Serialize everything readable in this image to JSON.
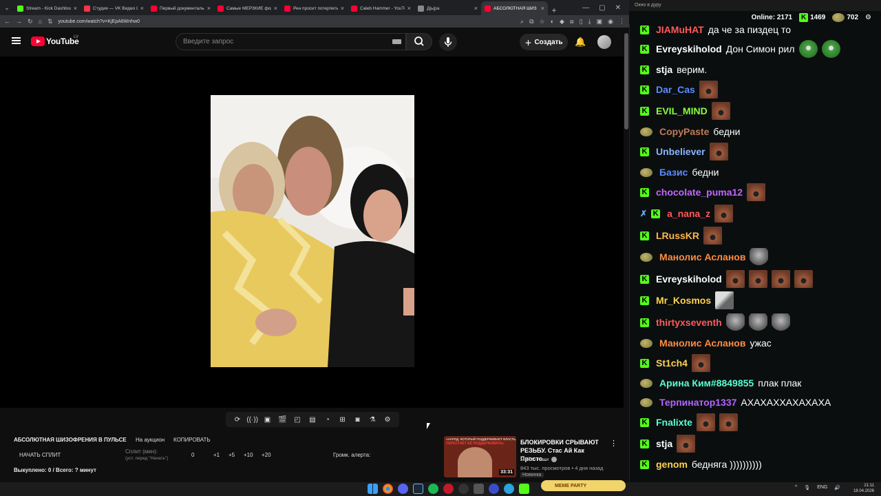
{
  "browser": {
    "tabs": [
      {
        "label": "Stream - Kick Dashboard",
        "color": "#53fc18"
      },
      {
        "label": "Студия — VK Видео Li",
        "color": "#ff3347"
      },
      {
        "label": "Первый документальн",
        "color": "#ff0033"
      },
      {
        "label": "Самые МЕРЗКИЕ фору",
        "color": "#ff0033"
      },
      {
        "label": "Рен просит потерпеть",
        "color": "#ff0033"
      },
      {
        "label": "Caleb Hammer - YouTu",
        "color": "#ff0033"
      },
      {
        "label": "Д|ь|ра",
        "color": "#888888"
      },
      {
        "label": "АБСОЛЮТНАЯ ШИЗ",
        "color": "#ff0033"
      }
    ],
    "url": "youtube.com/watch?v=KjEpA6Wnhw0"
  },
  "youtube": {
    "logo": "YouTube",
    "country": "LV",
    "search_placeholder": "Введите запрос",
    "create_label": "Создать"
  },
  "auction": {
    "title": "АБСОЛЮТНАЯ ШИЗОФРЕНИЯ В ПУЛЬСЕ",
    "on_auction": "На аукцион",
    "copy": "КОПИРОВАТЬ",
    "start_split": "НАЧАТЬ СПЛИТ",
    "split_label": "Сплит (мин):",
    "split_hint": "(уст. перед \"Начать\")",
    "split_value": "0",
    "plus1": "+1",
    "plus5": "+5",
    "plus10": "+10",
    "plus20": "+20",
    "alert_volume": "Громк. алерта:",
    "bought": "Выкуплено: 0 / Всего: ? минут"
  },
  "recommendation": {
    "thumb_text_top": "«НАРОД, КОТОРЫЙ ПОДДЕРЖИВАЕТ ВЛАСТЬ,",
    "thumb_text_main": "ПЕРЕСТАЁТ ЕЁ ПОДДЕРЖИВАТЬ»",
    "duration": "33:31",
    "title": "БЛОКИРОВКИ СРЫВАЮТ РЕЗЬБУ. Стас Ай Как Просто...",
    "channel": "Майкл Наки",
    "meta": "843 тыс. просмотров • 4 дня назад",
    "badge": "Новинка"
  },
  "chat": {
    "window_title": "Окно в дуру",
    "online_label": "Online:",
    "online": "2171",
    "kick_count": "1469",
    "other_count": "702",
    "messages": [
      {
        "user": "JIAMuHAT",
        "text": "да че за пиздец то",
        "color": "#ff5a5a"
      },
      {
        "user": "Evreyskiholod",
        "text": "Дон Симон рил",
        "color": "#ffffff"
      },
      {
        "user": "stja",
        "text": "верим.",
        "color": "#ffffff"
      },
      {
        "user": "Dar_Cas",
        "text": "",
        "color": "#5a8cff"
      },
      {
        "user": "EVIL_MIND",
        "text": "",
        "color": "#8bff3c"
      },
      {
        "user": "CopyPaste",
        "text": "бедни",
        "color": "#c07a5a"
      },
      {
        "user": "Unbeliever",
        "text": "",
        "color": "#8ab4ff"
      },
      {
        "user": "Базис",
        "text": "бедни",
        "color": "#5a8cff"
      },
      {
        "user": "chocolate_puma12",
        "text": "",
        "color": "#c266ff"
      },
      {
        "user": "a_nana_z",
        "text": "",
        "color": "#ff5a5a"
      },
      {
        "user": "LRussKR",
        "text": "",
        "color": "#ffb84d"
      },
      {
        "user": "Манолис Асланов",
        "text": "",
        "color": "#ff8c42"
      },
      {
        "user": "Evreyskiholod",
        "text": "",
        "color": "#ffffff"
      },
      {
        "user": "Mr_Kosmos",
        "text": "",
        "color": "#ffd24d"
      },
      {
        "user": "thirtyxseventh",
        "text": "",
        "color": "#ff5a5a"
      },
      {
        "user": "Манолис Асланов",
        "text": "ужас",
        "color": "#ff8c42"
      },
      {
        "user": "St1ch4",
        "text": "",
        "color": "#ffd24d"
      },
      {
        "user": "Арина Ким#8849855",
        "text": "плак плак",
        "color": "#5affd2"
      },
      {
        "user": "Терпинатор1337",
        "text": "АХАХАХХАХАХАХА",
        "color": "#b266ff"
      },
      {
        "user": "Fnalixte",
        "text": "",
        "color": "#5affd2"
      },
      {
        "user": "stja",
        "text": "",
        "color": "#ffffff"
      },
      {
        "user": "genom",
        "text": "бедняга ))))))))))",
        "color": "#ffd24d"
      }
    ]
  },
  "taskbar": {
    "meme_party": "MEME PARTY",
    "lang": "ENG",
    "time": "21:11",
    "date": "18.04.2026"
  }
}
